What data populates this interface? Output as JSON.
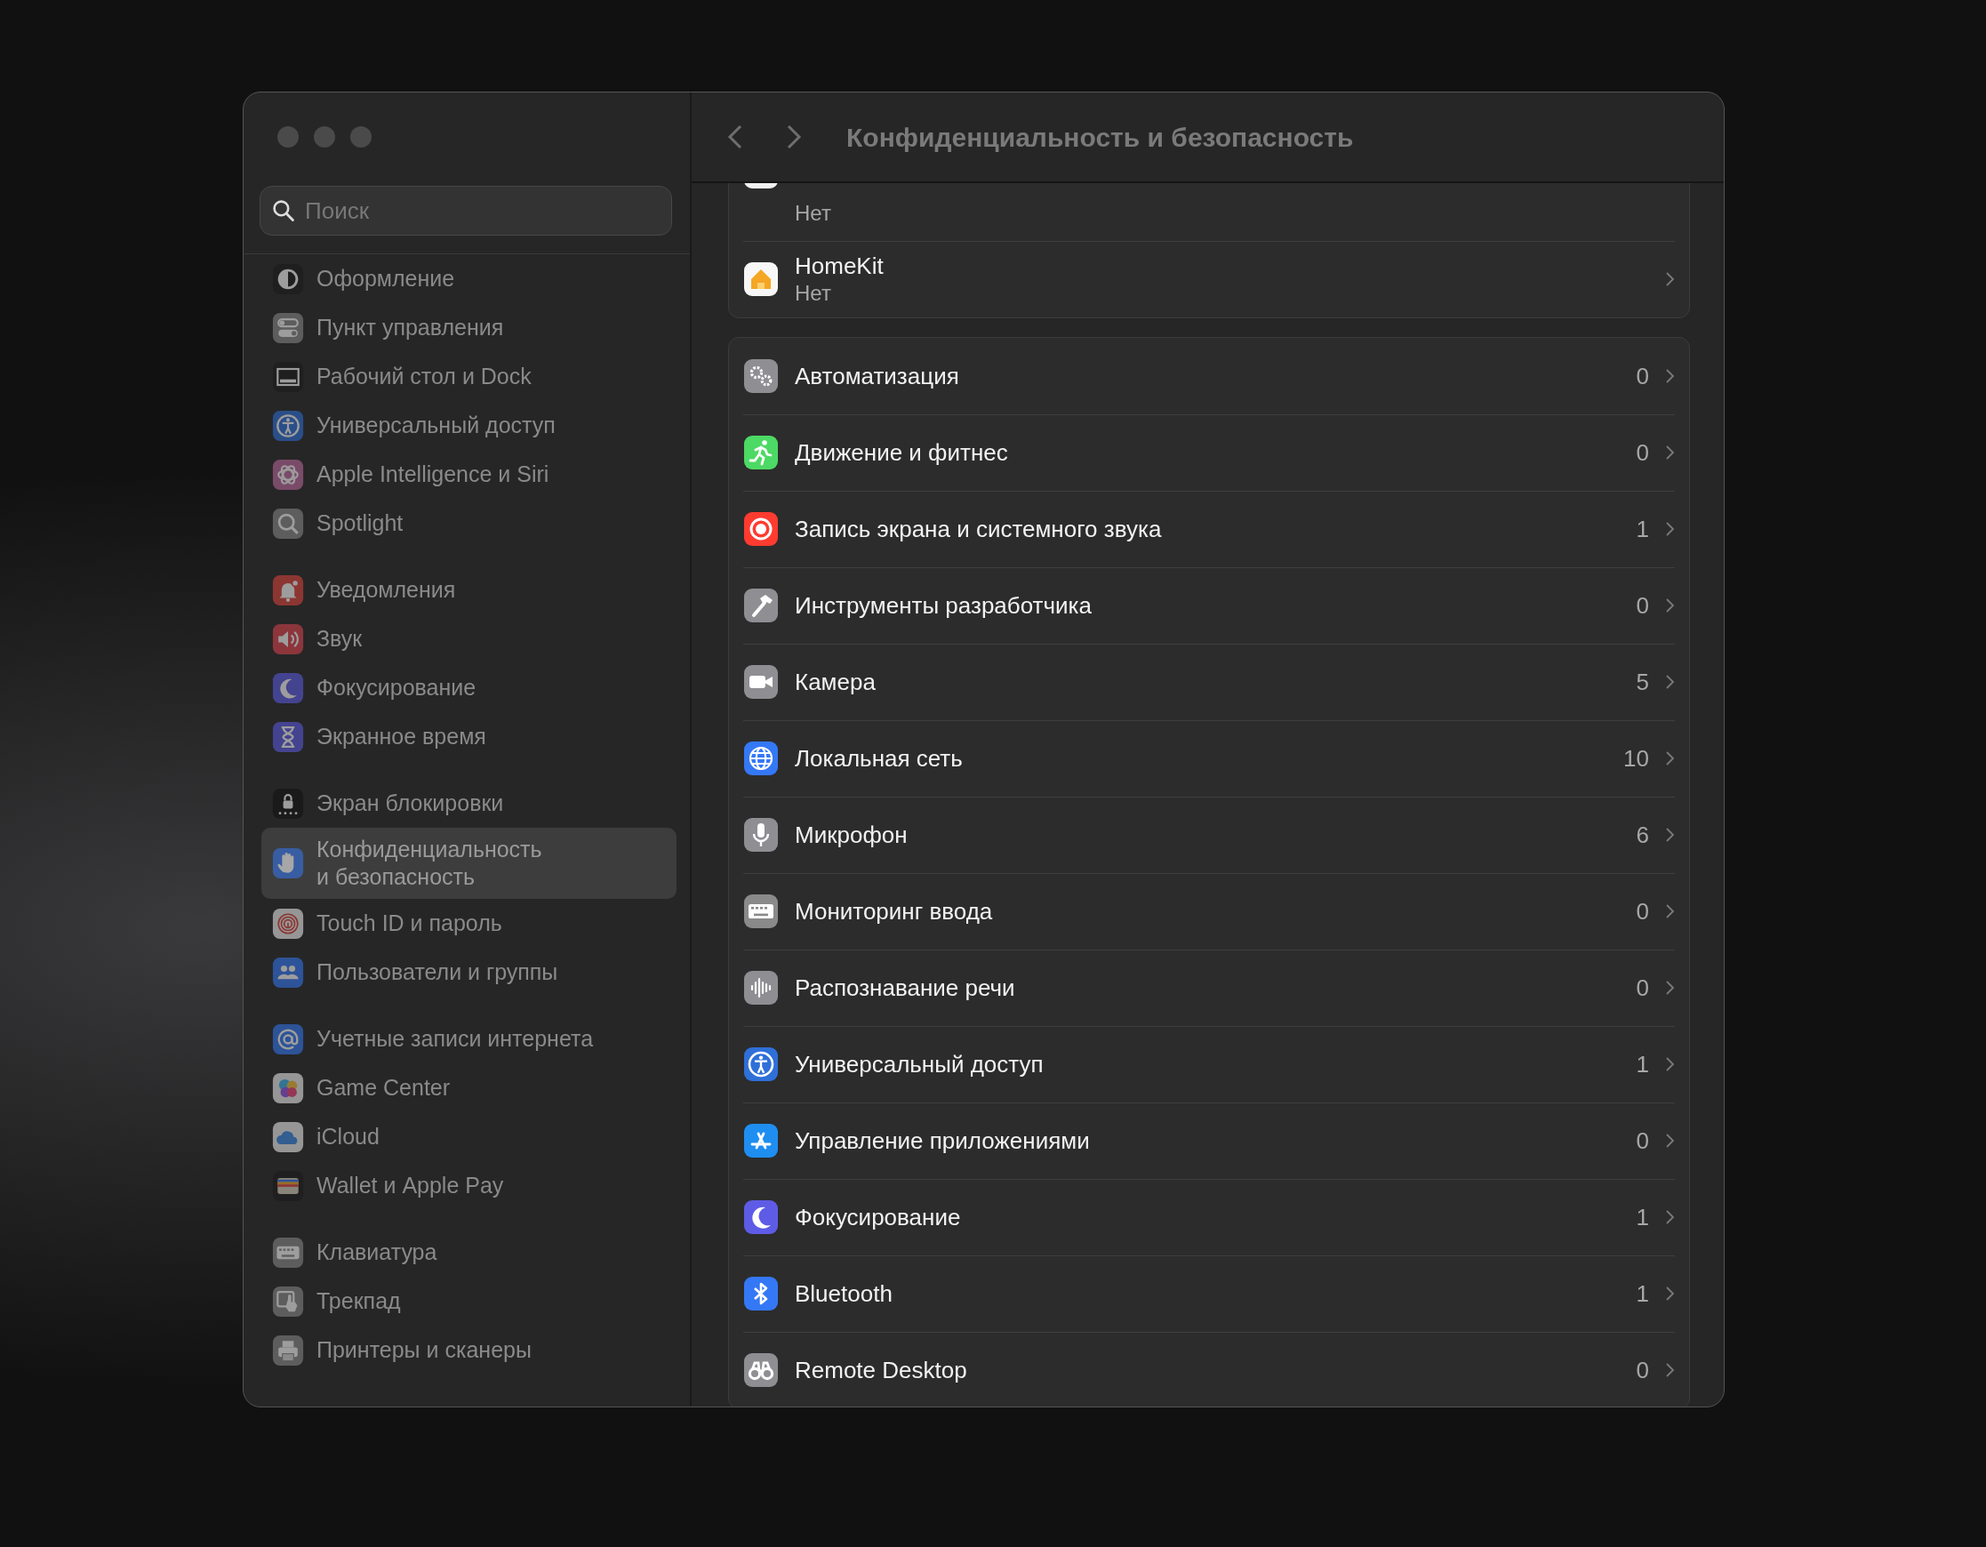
{
  "window": {
    "title": "Конфиденциальность и безопасность"
  },
  "sidebar": {
    "search": {
      "placeholder": "Поиск"
    },
    "groups": [
      {
        "items": [
          {
            "label": "Оформление",
            "selected": false
          },
          {
            "label": "Пункт управления",
            "selected": false
          },
          {
            "label": "Рабочий стол и Dock",
            "selected": false
          },
          {
            "label": "Универсальный доступ",
            "selected": false
          },
          {
            "label": "Apple Intelligence и Siri",
            "selected": false
          },
          {
            "label": "Spotlight",
            "selected": false
          }
        ]
      },
      {
        "items": [
          {
            "label": "Уведомления",
            "selected": false
          },
          {
            "label": "Звук",
            "selected": false
          },
          {
            "label": "Фокусирование",
            "selected": false
          },
          {
            "label": "Экранное время",
            "selected": false
          }
        ]
      },
      {
        "items": [
          {
            "label": "Экран блокировки",
            "selected": false
          },
          {
            "label": "Конфиденциальность\nи безопасность",
            "selected": true
          },
          {
            "label": "Touch ID и пароль",
            "selected": false
          },
          {
            "label": "Пользователи и группы",
            "selected": false
          }
        ]
      },
      {
        "items": [
          {
            "label": "Учетные записи интернета",
            "selected": false
          },
          {
            "label": "Game Center",
            "selected": false
          },
          {
            "label": "iCloud",
            "selected": false
          },
          {
            "label": "Wallet и Apple Pay",
            "selected": false
          }
        ]
      },
      {
        "items": [
          {
            "label": "Клавиатура",
            "selected": false
          },
          {
            "label": "Трекпад",
            "selected": false
          },
          {
            "label": "Принтеры и сканеры",
            "selected": false
          }
        ]
      }
    ]
  },
  "cards": [
    {
      "rows": [
        {
          "subtitle": "Нет"
        },
        {
          "title": "HomeKit",
          "subtitle": "Нет"
        }
      ]
    },
    {
      "rows": [
        {
          "title": "Автоматизация",
          "count": "0"
        },
        {
          "title": "Движение и фитнес",
          "count": "0"
        },
        {
          "title": "Запись экрана и системного звука",
          "count": "1"
        },
        {
          "title": "Инструменты разработчика",
          "count": "0"
        },
        {
          "title": "Камера",
          "count": "5"
        },
        {
          "title": "Локальная сеть",
          "count": "10"
        },
        {
          "title": "Микрофон",
          "count": "6"
        },
        {
          "title": "Мониторинг ввода",
          "count": "0"
        },
        {
          "title": "Распознавание речи",
          "count": "0"
        },
        {
          "title": "Универсальный доступ",
          "count": "1"
        },
        {
          "title": "Управление приложениями",
          "count": "0"
        },
        {
          "title": "Фокусирование",
          "count": "1"
        },
        {
          "title": "Bluetooth",
          "count": "1"
        },
        {
          "title": "Remote Desktop",
          "count": "0"
        }
      ]
    }
  ]
}
